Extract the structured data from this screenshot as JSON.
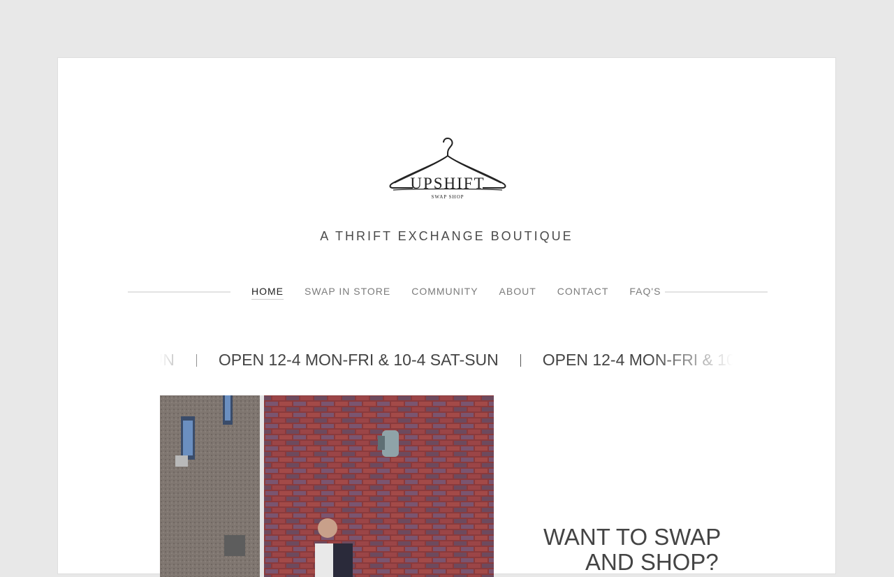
{
  "brand": {
    "logo_word": "UPSHIFT",
    "logo_sub": "SWAP SHOP",
    "tagline": "A THRIFT EXCHANGE BOUTIQUE"
  },
  "nav": {
    "items": [
      {
        "label": "HOME",
        "active": true
      },
      {
        "label": "SWAP IN STORE",
        "active": false
      },
      {
        "label": "COMMUNITY",
        "active": false
      },
      {
        "label": "ABOUT",
        "active": false
      },
      {
        "label": "CONTACT",
        "active": false
      },
      {
        "label": "FAQ'S",
        "active": false
      }
    ]
  },
  "ticker": {
    "text": "OPEN 12-4 MON-FRI & 10-4 SAT-SUN"
  },
  "hero": {
    "headline_line1": "WANT TO SWAP",
    "headline_line2": "AND SHOP?"
  },
  "colors": {
    "page_bg": "#e8e8e8",
    "card_bg": "#ffffff",
    "text_dark": "#444444",
    "nav_text": "#7b7b7b"
  },
  "icons": {
    "logo": "hanger-icon"
  }
}
